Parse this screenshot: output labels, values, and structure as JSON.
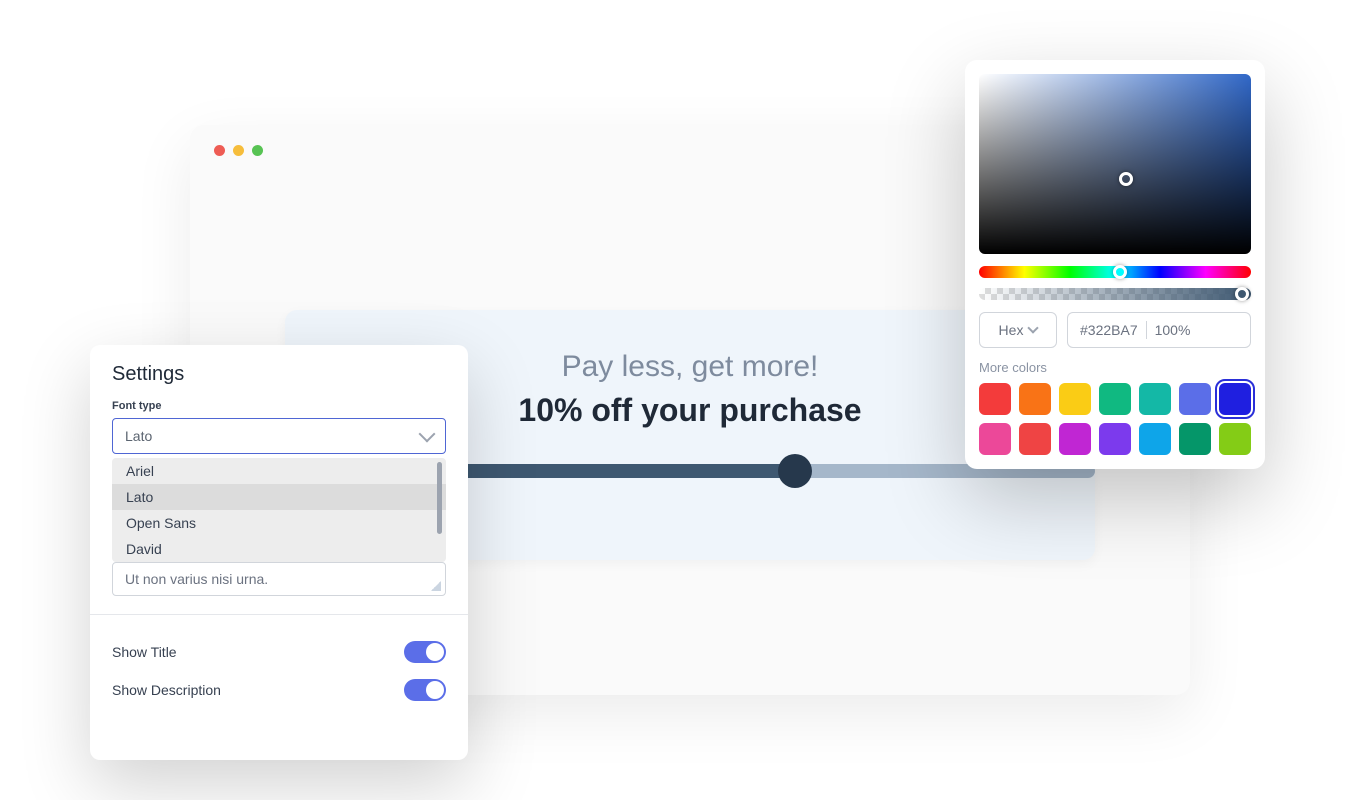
{
  "traffic": {
    "red": "#ee5c54",
    "yellow": "#f6bd3b",
    "green": "#57c353"
  },
  "promo": {
    "title": "Pay less, get more!",
    "subtitle": "10% off your purchase",
    "slider_percent": 63
  },
  "settings": {
    "title": "Settings",
    "font_label": "Font type",
    "font_selected": "Lato",
    "font_options": [
      "Ariel",
      "Lato",
      "Open Sans",
      "David"
    ],
    "textarea": "Ut non varius nisi urna.",
    "show_title": {
      "label": "Show Title",
      "on": true
    },
    "show_desc": {
      "label": "Show Description",
      "on": true
    }
  },
  "picker": {
    "format": "Hex",
    "hex": "#322BA7",
    "alpha": "100%",
    "more_label": "More colors",
    "swatches": [
      "#f33b3b",
      "#f97316",
      "#facc15",
      "#10b981",
      "#14b8a6",
      "#5b6ee8",
      "#1f1fe0",
      "#ec4899",
      "#ef4444",
      "#c026d3",
      "#7c3aed",
      "#0ea5e9",
      "#059669",
      "#84cc16"
    ],
    "selected_index": 6
  }
}
